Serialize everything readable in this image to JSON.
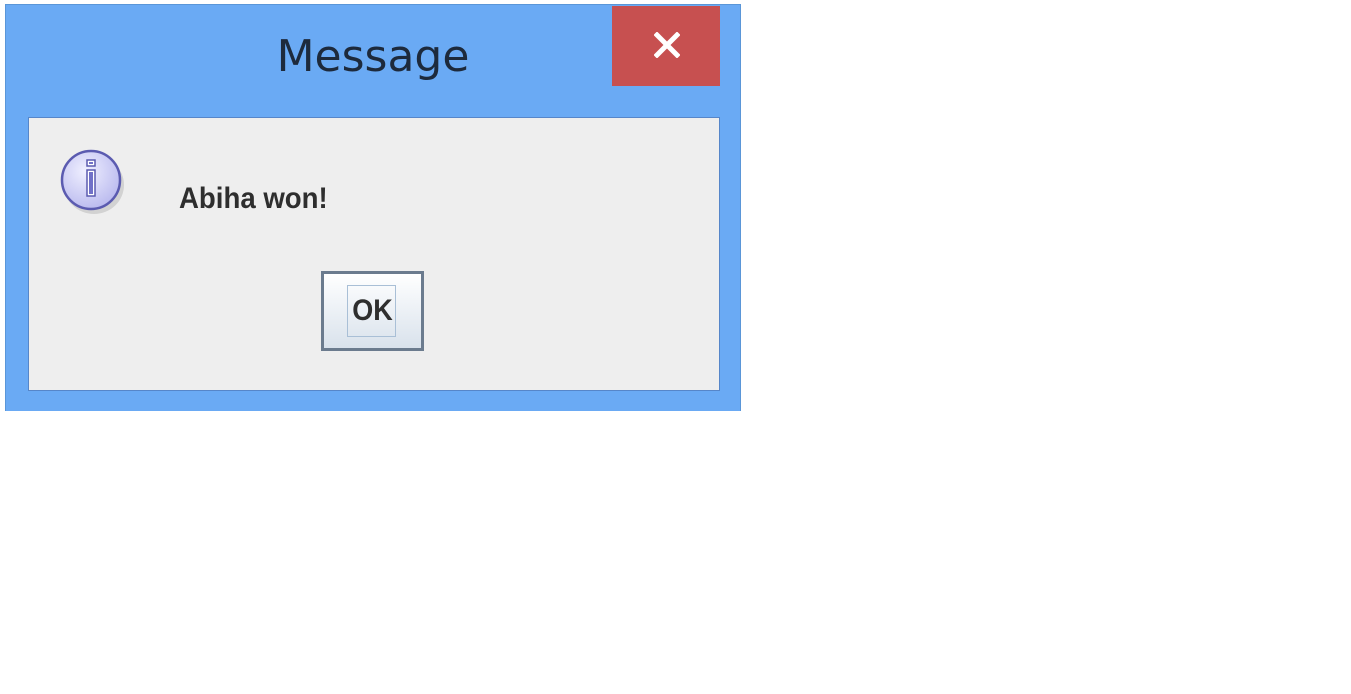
{
  "dialog": {
    "title": "Message",
    "close_icon": "close-x-icon",
    "message_icon": "information-icon",
    "message": "Abiha won!",
    "ok_label": "OK"
  },
  "colors": {
    "frame": "#6aaaf4",
    "close_button": "#c75050",
    "content_background": "#eeeeee",
    "content_border": "#5686c9",
    "icon_fill": "#c9c9f5",
    "icon_stroke": "#5b5bb0"
  }
}
